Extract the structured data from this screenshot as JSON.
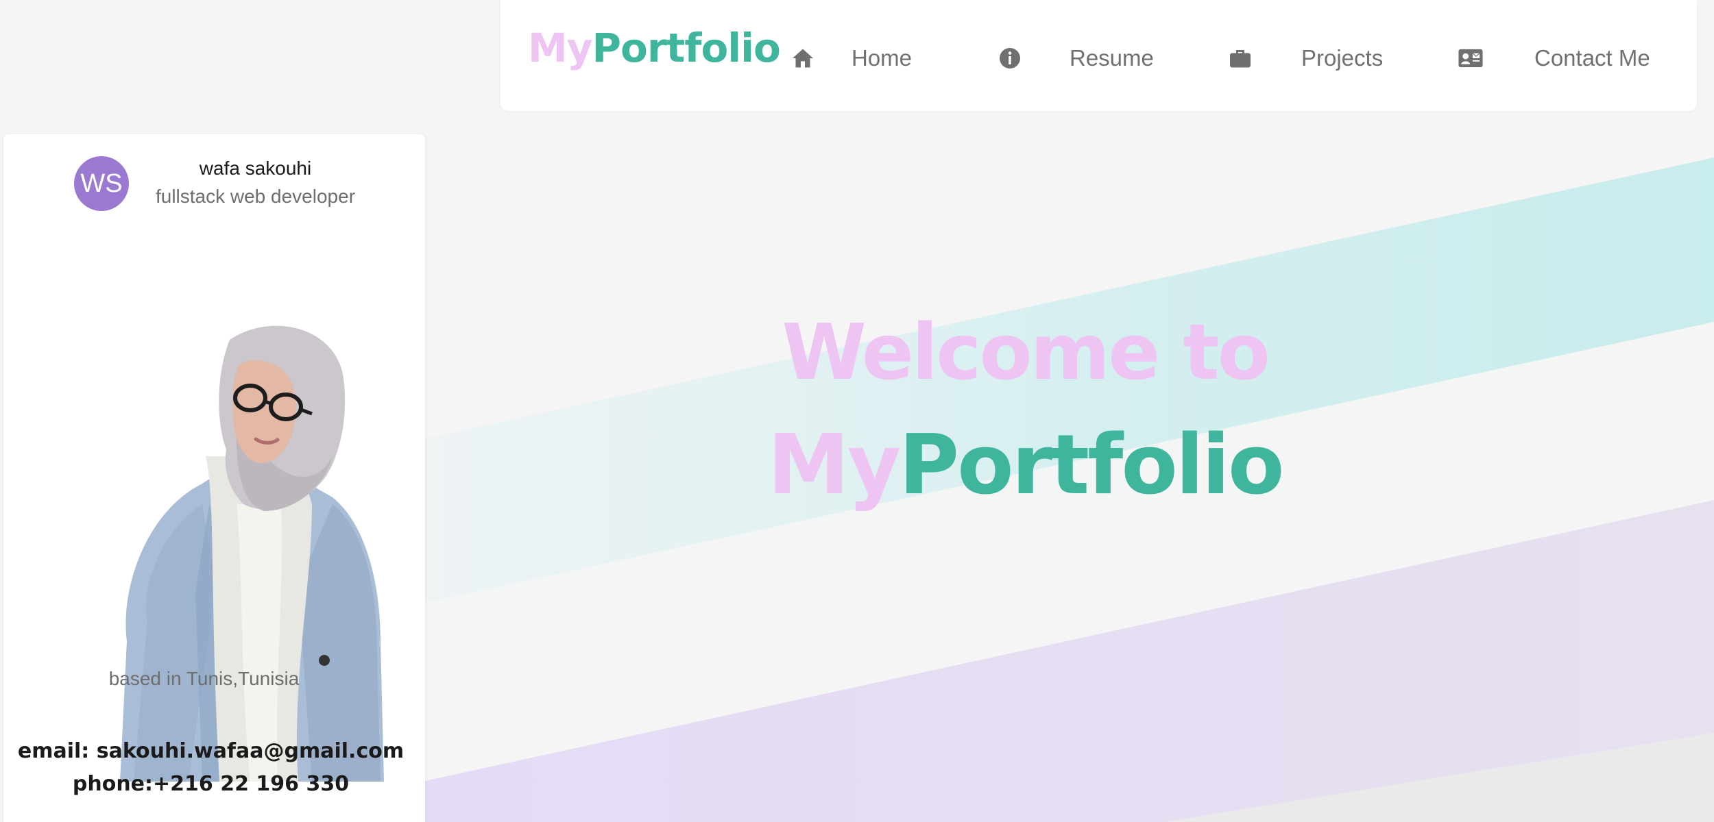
{
  "colors": {
    "brand_my": "#eec4f2",
    "brand_portfolio": "#3fb59e",
    "avatar_bg": "#9a7ad0",
    "nav_text": "#707070",
    "teal_band": "#cdecec",
    "lavender_band": "#e3d9f3"
  },
  "navbar": {
    "brand_my": "My",
    "brand_portfolio": "Portfolio",
    "items": [
      {
        "label": "Home",
        "icon": "home-icon"
      },
      {
        "label": "Resume",
        "icon": "info-icon"
      },
      {
        "label": "Projects",
        "icon": "briefcase-icon"
      },
      {
        "label": "Contact Me",
        "icon": "contact-card-icon"
      }
    ]
  },
  "profile": {
    "initials": "WS",
    "name": "wafa sakouhi",
    "role": "fullstack web developer",
    "location": "based in Tunis,Tunisia",
    "email": "email: sakouhi.wafaa@gmail.com",
    "phone": "phone:+216 22 196 330"
  },
  "hero": {
    "line1": "Welcome to",
    "line2_my": "My",
    "line2_portfolio": "Portfolio"
  }
}
